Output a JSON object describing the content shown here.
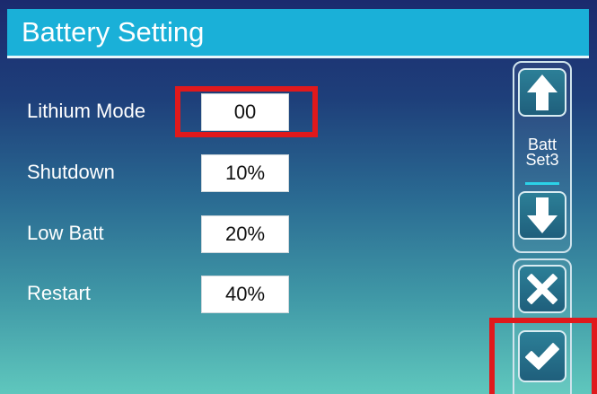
{
  "header": {
    "title": "Battery Setting"
  },
  "fields": [
    {
      "label": "Lithium Mode",
      "value": "00"
    },
    {
      "label": "Shutdown",
      "value": "10%"
    },
    {
      "label": "Low Batt",
      "value": "20%"
    },
    {
      "label": "Restart",
      "value": "40%"
    }
  ],
  "nav": {
    "page_label_line1": "Batt",
    "page_label_line2": "Set3",
    "up_icon": "arrow-up",
    "down_icon": "arrow-down",
    "cancel_icon": "x-cross",
    "confirm_icon": "checkmark"
  },
  "colors": {
    "title_bar": "#1ab0d8",
    "highlight": "#e0191c",
    "background_top": "#1b2a6e",
    "background_bottom": "#5fc7bd"
  }
}
